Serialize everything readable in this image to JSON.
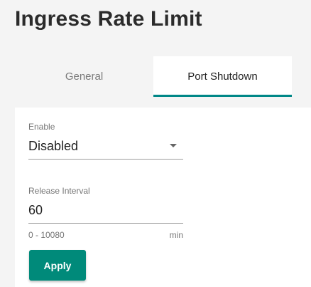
{
  "page": {
    "title": "Ingress Rate Limit"
  },
  "tabs": [
    {
      "label": "General",
      "active": false
    },
    {
      "label": "Port Shutdown",
      "active": true
    }
  ],
  "form": {
    "enable": {
      "label": "Enable",
      "value": "Disabled"
    },
    "release_interval": {
      "label": "Release Interval",
      "value": "60",
      "range_hint": "0 - 10080",
      "unit": "min"
    },
    "apply_label": "Apply"
  },
  "colors": {
    "accent": "#008787",
    "apply_button": "#008a7a"
  },
  "icons": {
    "select_arrow": "chevron-down-icon"
  }
}
